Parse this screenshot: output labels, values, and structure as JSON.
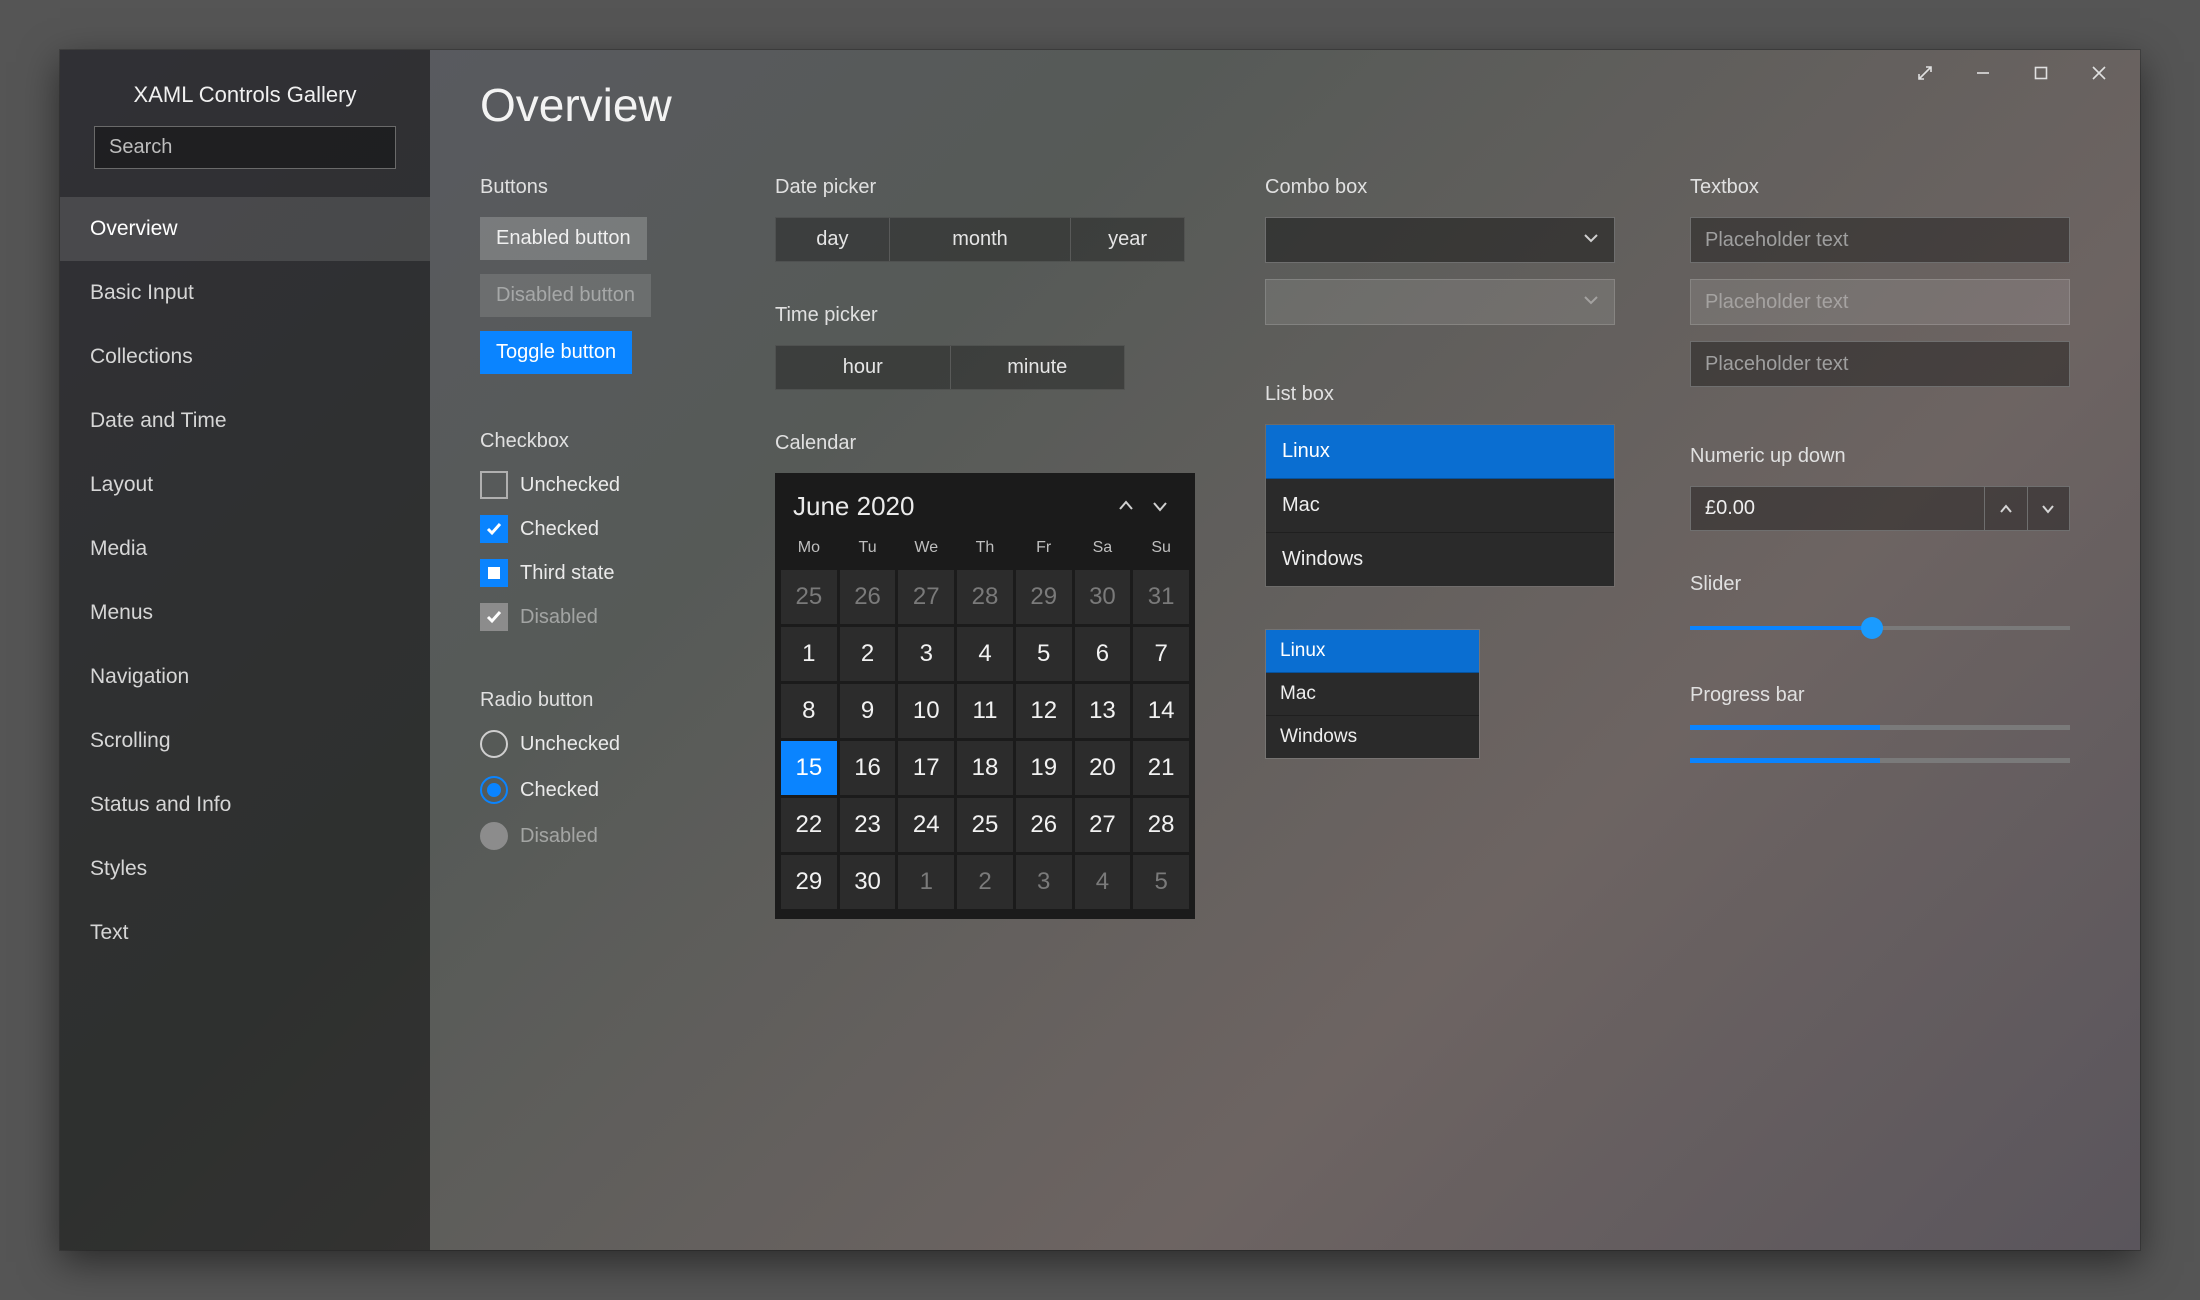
{
  "app_title": "XAML Controls Gallery",
  "search_placeholder": "Search",
  "sidebar": {
    "items": [
      "Overview",
      "Basic Input",
      "Collections",
      "Date and Time",
      "Layout",
      "Media",
      "Menus",
      "Navigation",
      "Scrolling",
      "Status and Info",
      "Styles",
      "Text"
    ],
    "selected_index": 0
  },
  "page": {
    "title": "Overview"
  },
  "sections": {
    "buttons": {
      "label": "Buttons",
      "enabled": "Enabled button",
      "disabled": "Disabled button",
      "toggle": "Toggle button"
    },
    "checkbox": {
      "label": "Checkbox",
      "unchecked": "Unchecked",
      "checked": "Checked",
      "third": "Third state",
      "disabled": "Disabled"
    },
    "radio": {
      "label": "Radio button",
      "unchecked": "Unchecked",
      "checked": "Checked",
      "disabled": "Disabled"
    },
    "datepicker": {
      "label": "Date picker",
      "day": "day",
      "month": "month",
      "year": "year"
    },
    "timepicker": {
      "label": "Time picker",
      "hour": "hour",
      "minute": "minute"
    },
    "calendar": {
      "label": "Calendar",
      "title": "June 2020",
      "dow": [
        "Mo",
        "Tu",
        "We",
        "Th",
        "Fr",
        "Sa",
        "Su"
      ],
      "days": [
        {
          "d": 25,
          "other": true
        },
        {
          "d": 26,
          "other": true
        },
        {
          "d": 27,
          "other": true
        },
        {
          "d": 28,
          "other": true
        },
        {
          "d": 29,
          "other": true
        },
        {
          "d": 30,
          "other": true
        },
        {
          "d": 31,
          "other": true
        },
        {
          "d": 1
        },
        {
          "d": 2
        },
        {
          "d": 3
        },
        {
          "d": 4
        },
        {
          "d": 5
        },
        {
          "d": 6
        },
        {
          "d": 7
        },
        {
          "d": 8
        },
        {
          "d": 9
        },
        {
          "d": 10
        },
        {
          "d": 11
        },
        {
          "d": 12
        },
        {
          "d": 13
        },
        {
          "d": 14
        },
        {
          "d": 15,
          "selected": true
        },
        {
          "d": 16
        },
        {
          "d": 17
        },
        {
          "d": 18
        },
        {
          "d": 19
        },
        {
          "d": 20
        },
        {
          "d": 21
        },
        {
          "d": 22
        },
        {
          "d": 23
        },
        {
          "d": 24
        },
        {
          "d": 25
        },
        {
          "d": 26
        },
        {
          "d": 27
        },
        {
          "d": 28
        },
        {
          "d": 29
        },
        {
          "d": 30
        },
        {
          "d": 1,
          "other": true
        },
        {
          "d": 2,
          "other": true
        },
        {
          "d": 3,
          "other": true
        },
        {
          "d": 4,
          "other": true
        },
        {
          "d": 5,
          "other": true
        }
      ]
    },
    "combo": {
      "label": "Combo box"
    },
    "listbox": {
      "label": "List box",
      "items": [
        "Linux",
        "Mac",
        "Windows"
      ],
      "selected_index": 0
    },
    "listbox_small": {
      "items": [
        "Linux",
        "Mac",
        "Windows"
      ],
      "selected_index": 0
    },
    "textbox": {
      "label": "Textbox",
      "placeholder": "Placeholder text"
    },
    "numeric": {
      "label": "Numeric up down",
      "value": "£0.00"
    },
    "slider": {
      "label": "Slider",
      "percent": 48
    },
    "progress": {
      "label": "Progress bar",
      "value1": 50,
      "value2": 50
    }
  }
}
